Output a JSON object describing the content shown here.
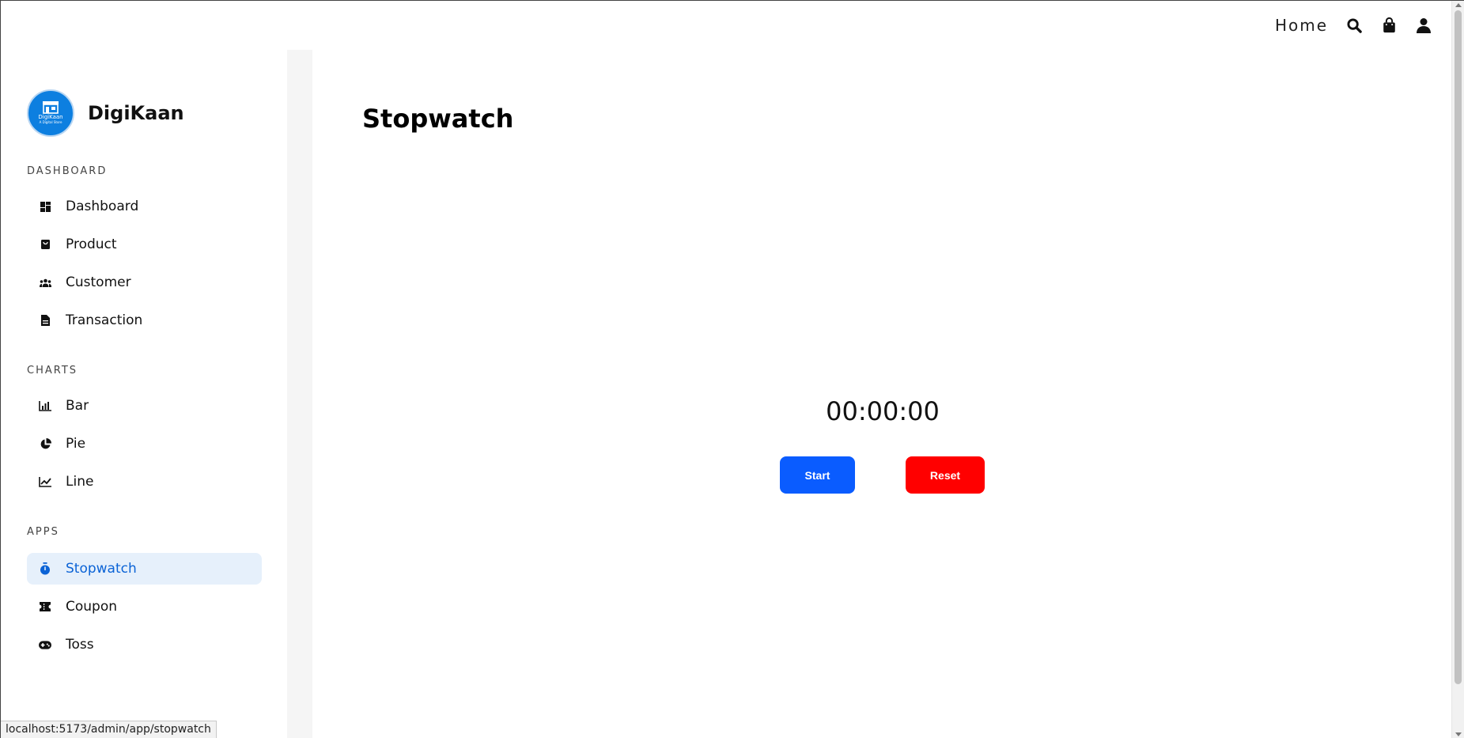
{
  "topnav": {
    "home_label": "Home",
    "icons": [
      "search-icon",
      "shopping-bag-icon",
      "user-icon"
    ]
  },
  "brand": {
    "name": "DigiKaan",
    "logo_text": "DigiKaan",
    "logo_subtext": "A Digital Store"
  },
  "sidebar": {
    "sections": [
      {
        "title": "DASHBOARD",
        "items": [
          {
            "label": "Dashboard",
            "icon": "dashboard-icon"
          },
          {
            "label": "Product",
            "icon": "product-bag-icon"
          },
          {
            "label": "Customer",
            "icon": "customers-icon"
          },
          {
            "label": "Transaction",
            "icon": "document-icon"
          }
        ]
      },
      {
        "title": "CHARTS",
        "items": [
          {
            "label": "Bar",
            "icon": "bar-chart-icon"
          },
          {
            "label": "Pie",
            "icon": "pie-chart-icon"
          },
          {
            "label": "Line",
            "icon": "line-chart-icon"
          }
        ]
      },
      {
        "title": "APPS",
        "items": [
          {
            "label": "Stopwatch",
            "icon": "stopwatch-icon",
            "active": true
          },
          {
            "label": "Coupon",
            "icon": "coupon-icon"
          },
          {
            "label": "Toss",
            "icon": "gamepad-icon"
          }
        ]
      }
    ]
  },
  "main": {
    "title": "Stopwatch",
    "timer": "00:00:00",
    "start_label": "Start",
    "reset_label": "Reset"
  },
  "colors": {
    "accent": "#0b63d6",
    "active_bg": "#e6f0fb",
    "start_btn": "#0a5cff",
    "reset_btn": "#ff0000",
    "logo_bg": "#0d7fe0"
  },
  "status_bar": {
    "url": "localhost:5173/admin/app/stopwatch"
  }
}
